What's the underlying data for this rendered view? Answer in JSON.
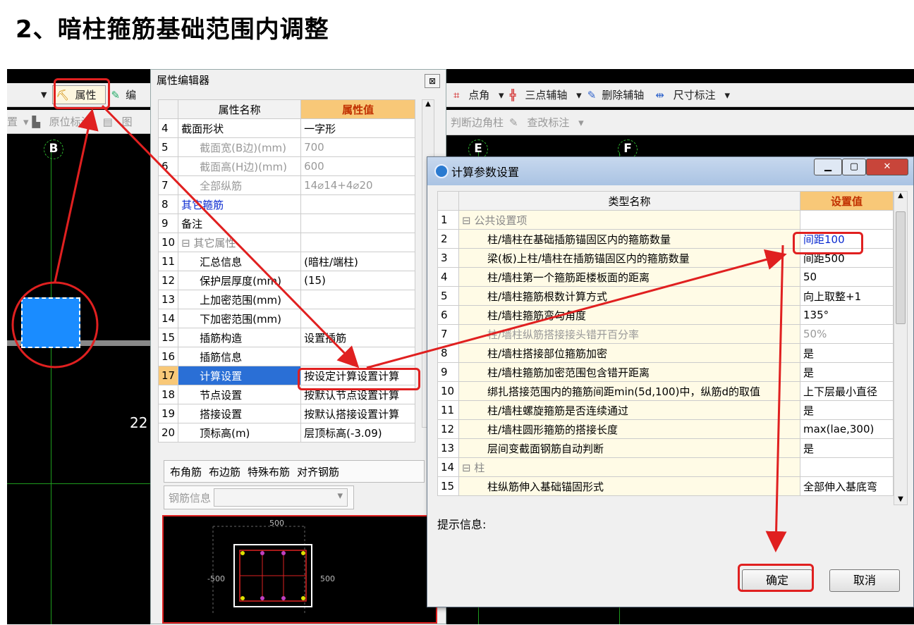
{
  "heading": "2、暗柱箍筋基础范围内调整",
  "toolbar_left": {
    "prop_btn": "属性",
    "edit_btn": "编",
    "set_btn": "置",
    "orig_btn": "原位标注",
    "pic_btn": "图"
  },
  "toolbar_right": {
    "row1": [
      "点角",
      "三点辅轴",
      "删除辅轴",
      "尺寸标注"
    ],
    "row2": [
      "判断边角柱",
      "查改标注"
    ]
  },
  "axis_labels": [
    "B",
    "E",
    "F"
  ],
  "cad_number": "22",
  "prop_editor": {
    "title": "属性编辑器",
    "close": "⊠",
    "col_name": "属性名称",
    "col_value": "属性值",
    "rows": [
      {
        "n": "4",
        "name": "截面形状",
        "val": "一字形",
        "style": "normal"
      },
      {
        "n": "5",
        "name": "截面宽(B边)(mm)",
        "val": "700",
        "style": "gray"
      },
      {
        "n": "6",
        "name": "截面高(H边)(mm)",
        "val": "600",
        "style": "gray"
      },
      {
        "n": "7",
        "name": "全部纵筋",
        "val": "14⌀14+4⌀20",
        "style": "gray"
      },
      {
        "n": "8",
        "name": "其它箍筋",
        "val": "",
        "style": "blue"
      },
      {
        "n": "9",
        "name": "备注",
        "val": "",
        "style": "normal"
      },
      {
        "n": "10",
        "name": "⊟ 其它属性",
        "val": "",
        "style": "group"
      },
      {
        "n": "11",
        "name": "汇总信息",
        "val": "(暗柱/端柱)",
        "style": "tree"
      },
      {
        "n": "12",
        "name": "保护层厚度(mm)",
        "val": "(15)",
        "style": "tree"
      },
      {
        "n": "13",
        "name": "上加密范围(mm)",
        "val": "",
        "style": "tree"
      },
      {
        "n": "14",
        "name": "下加密范围(mm)",
        "val": "",
        "style": "tree"
      },
      {
        "n": "15",
        "name": "插筋构造",
        "val": "设置插筋",
        "style": "tree"
      },
      {
        "n": "16",
        "name": "插筋信息",
        "val": "",
        "style": "tree"
      },
      {
        "n": "17",
        "name": "计算设置",
        "val": "按设定计算设置计算",
        "style": "selected"
      },
      {
        "n": "18",
        "name": "节点设置",
        "val": "按默认节点设置计算",
        "style": "tree"
      },
      {
        "n": "19",
        "name": "搭接设置",
        "val": "按默认搭接设置计算",
        "style": "tree"
      },
      {
        "n": "20",
        "name": "顶标高(m)",
        "val": "层顶标高(-3.09)",
        "style": "tree"
      }
    ],
    "tabs": [
      "布角筋",
      "布边筋",
      "特殊布筋",
      "对齐钢筋"
    ],
    "rebar_label": "钢筋信息",
    "preview_labels": [
      "500",
      "-500",
      "500"
    ]
  },
  "dialog": {
    "title": "计算参数设置",
    "col_name": "类型名称",
    "col_value": "设置值",
    "rows": [
      {
        "n": "1",
        "name": "⊟ 公共设置项",
        "val": "",
        "style": "group"
      },
      {
        "n": "2",
        "name": "柱/墙柱在基础插筋锚固区内的箍筋数量",
        "val": "间距100",
        "style": "highlight"
      },
      {
        "n": "3",
        "name": "梁(板)上柱/墙柱在插筋锚固区内的箍筋数量",
        "val": "间距500",
        "style": "tree"
      },
      {
        "n": "4",
        "name": "柱/墙柱第一个箍筋距楼板面的距离",
        "val": "50",
        "style": "tree"
      },
      {
        "n": "5",
        "name": "柱/墙柱箍筋根数计算方式",
        "val": "向上取整+1",
        "style": "tree"
      },
      {
        "n": "6",
        "name": "柱/墙柱箍筋弯勾角度",
        "val": "135°",
        "style": "tree"
      },
      {
        "n": "7",
        "name": "柱/墙柱纵筋搭接接头错开百分率",
        "val": "50%",
        "style": "gray"
      },
      {
        "n": "8",
        "name": "柱/墙柱搭接部位箍筋加密",
        "val": "是",
        "style": "tree"
      },
      {
        "n": "9",
        "name": "柱/墙柱箍筋加密范围包含错开距离",
        "val": "是",
        "style": "tree"
      },
      {
        "n": "10",
        "name": "绑扎搭接范围内的箍筋间距min(5d,100)中，纵筋d的取值",
        "val": "上下层最小直径",
        "style": "tree"
      },
      {
        "n": "11",
        "name": "柱/墙柱螺旋箍筋是否连续通过",
        "val": "是",
        "style": "tree"
      },
      {
        "n": "12",
        "name": "柱/墙柱圆形箍筋的搭接长度",
        "val": "max(lae,300)",
        "style": "tree"
      },
      {
        "n": "13",
        "name": "层间变截面钢筋自动判断",
        "val": "是",
        "style": "tree"
      },
      {
        "n": "14",
        "name": "⊟ 柱",
        "val": "",
        "style": "group"
      },
      {
        "n": "15",
        "name": "柱纵筋伸入基础锚固形式",
        "val": "全部伸入基底弯",
        "style": "tree"
      }
    ],
    "hint_label": "提示信息:",
    "ok": "确定",
    "cancel": "取消"
  },
  "colors": {
    "annotation_red": "#e02020",
    "column_blue": "#1a8cff",
    "header_orange": "#f8c878"
  }
}
